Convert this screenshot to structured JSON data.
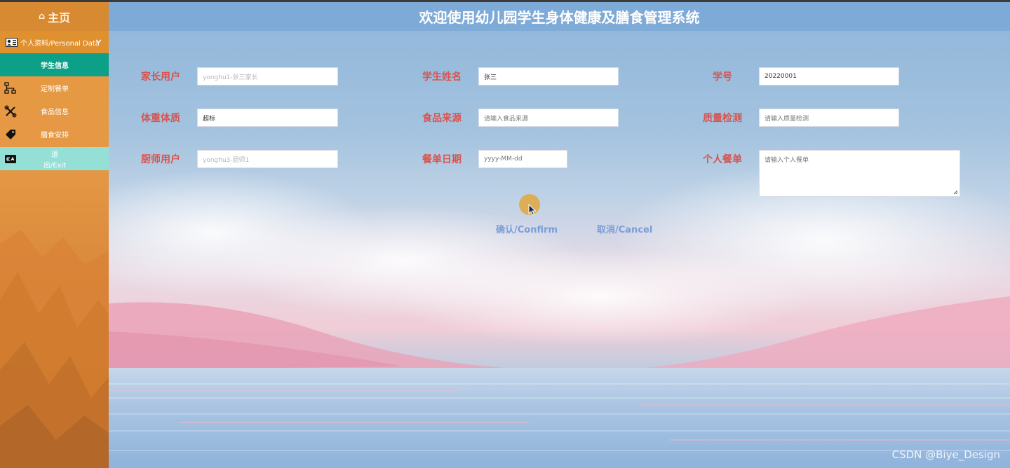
{
  "app": {
    "title": "欢迎使用幼儿园学生身体健康及膳食管理系统",
    "watermark": "CSDN @Biye_Design"
  },
  "sidebar": {
    "home_icon": "⌂",
    "home_label": "主页",
    "section_label": "个人资料/Personal Data",
    "items": [
      {
        "label": "学生信息",
        "icon": "none",
        "active": true
      },
      {
        "label": "定制餐单",
        "icon": "sitemap-icon"
      },
      {
        "label": "食品信息",
        "icon": "tools-icon"
      },
      {
        "label": "膳食安排",
        "icon": "tag-icon"
      },
      {
        "label": "退出/Exit",
        "icon": "exit-icon"
      }
    ]
  },
  "form": {
    "fields": {
      "parent_user": {
        "label": "家长用户",
        "placeholder": "yonghu1-张三家长"
      },
      "student_name": {
        "label": "学生姓名",
        "value": "张三"
      },
      "student_no": {
        "label": "学号",
        "value": "20220001"
      },
      "physique": {
        "label": "体重体质",
        "value": "超标"
      },
      "food_source": {
        "label": "食品来源",
        "placeholder": "请输入食品来源"
      },
      "quality_check": {
        "label": "质量检测",
        "placeholder": "请输入质量检测"
      },
      "chef_user": {
        "label": "厨师用户",
        "placeholder": "yonghu3-厨师1"
      },
      "menu_date": {
        "label": "餐单日期",
        "placeholder": "yyyy-MM-dd"
      },
      "personal_menu": {
        "label": "个人餐单",
        "placeholder": "请输入个人餐单"
      }
    },
    "confirm_label": "确认/Confirm",
    "cancel_label": "取消/Cancel"
  },
  "colors": {
    "sidebar": "#e59845",
    "active_item": "#0ba087",
    "exit_item": "#94e0d6",
    "header": "#7aa8d6",
    "field_label": "#d9534f",
    "button_text": "#7a9ed6"
  }
}
